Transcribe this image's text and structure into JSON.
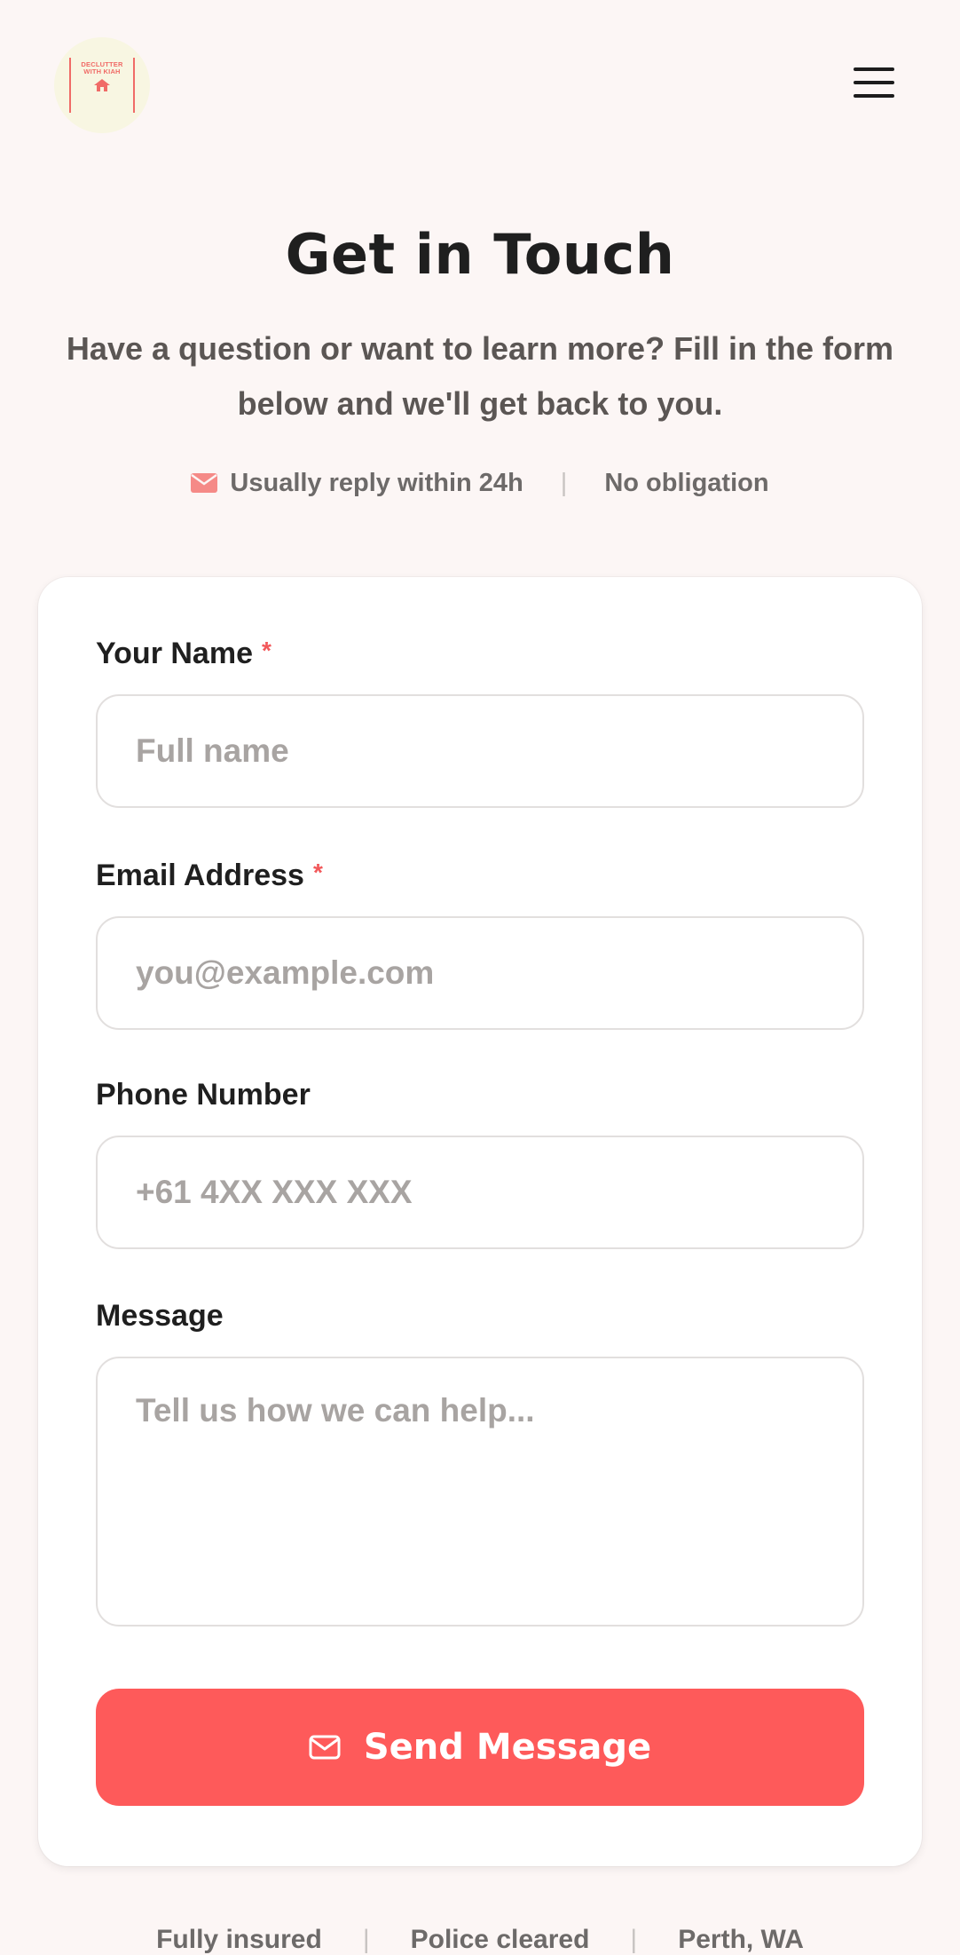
{
  "header": {
    "logo_text": "DECLUTTER WITH KIAH",
    "menu_icon": "hamburger-icon"
  },
  "hero": {
    "title": "Get in Touch",
    "subtitle": "Have a question or want to learn more? Fill in the form below and we'll get back to you.",
    "badges": [
      {
        "icon": "mail-icon",
        "label": "Usually reply within 24h"
      },
      {
        "label": "No obligation"
      }
    ],
    "separator": "|"
  },
  "form": {
    "fields": [
      {
        "label": "Your Name",
        "required": true,
        "required_mark": "*",
        "placeholder": "Full name",
        "value": ""
      },
      {
        "label": "Email Address",
        "required": true,
        "required_mark": "*",
        "placeholder": "you@example.com",
        "value": ""
      },
      {
        "label": "Phone Number",
        "required": false,
        "placeholder": "+61 4XX XXX XXX",
        "value": ""
      },
      {
        "label": "Message",
        "required": false,
        "placeholder": "Tell us how we can help...",
        "value": ""
      }
    ],
    "submit": {
      "label": "Send Message",
      "icon": "mail-icon"
    }
  },
  "footer": {
    "items": [
      "Fully insured",
      "Police cleared",
      "Perth, WA"
    ],
    "separator": "|"
  },
  "colors": {
    "accent": "#fe5a5a",
    "background": "#fcf6f5",
    "required": "#f2585a",
    "logo_bg": "#f8f6e2"
  }
}
